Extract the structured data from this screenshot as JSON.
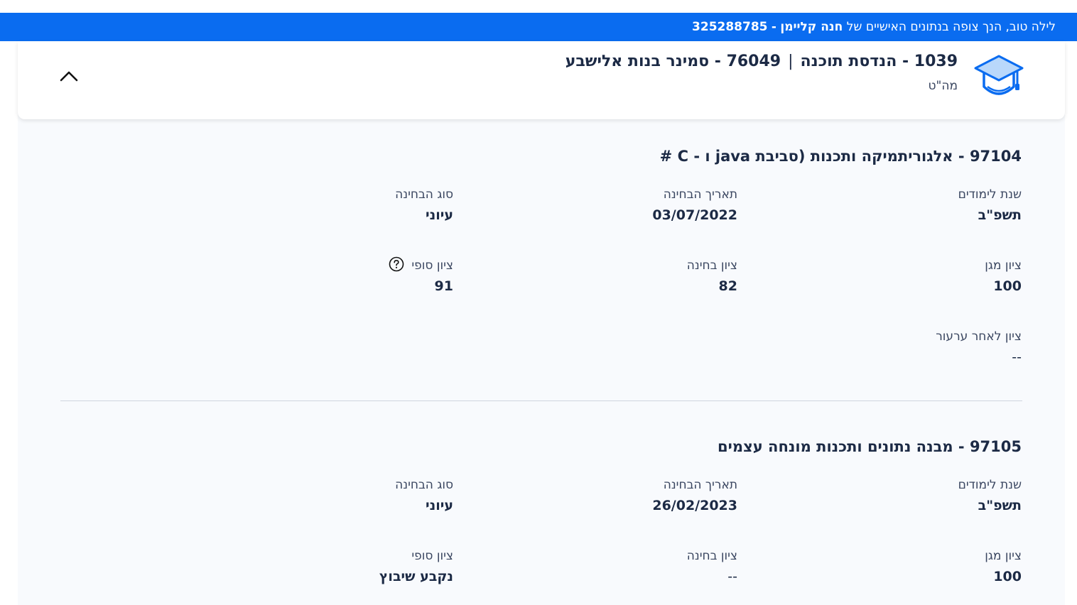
{
  "banner": {
    "greeting": "לילה טוב,",
    "viewing_text": "הנך צופה בנתונים האישיים של",
    "student_name": "חנה קליימן",
    "separator": "-",
    "student_id": "325288785",
    "color": "#0a6cf0"
  },
  "program": {
    "title_part1": "1039 - הנדסת תוכנה",
    "separator": "|",
    "title_part2": "76049 - סמינר בנות אלישבע",
    "degree": "מה\"ט",
    "icon": "graduation-cap-icon"
  },
  "labels": {
    "year": "שנת לימודים",
    "exam_date": "תאריך הבחינה",
    "exam_type": "סוג הבחינה",
    "magen_grade": "ציון מגן",
    "exam_grade": "ציון בחינה",
    "final_grade": "ציון סופי",
    "appeal_grade": "ציון לאחר ערעור"
  },
  "courses": [
    {
      "title": "97104 - אלגוריתמיקה ותכנות (סביבת java ו - C #",
      "year": "תשפ\"ב",
      "exam_date": "03/07/2022",
      "exam_type": "עיוני",
      "magen_grade": "100",
      "exam_grade": "82",
      "final_grade": "91",
      "appeal_grade": "--"
    },
    {
      "title": "97105 - מבנה נתונים ותכנות מונחה עצמים",
      "year": "תשפ\"ב",
      "exam_date": "26/02/2023",
      "exam_type": "עיוני",
      "magen_grade": "100",
      "exam_grade": "--",
      "final_grade": "נקבע שיבוץ"
    }
  ]
}
